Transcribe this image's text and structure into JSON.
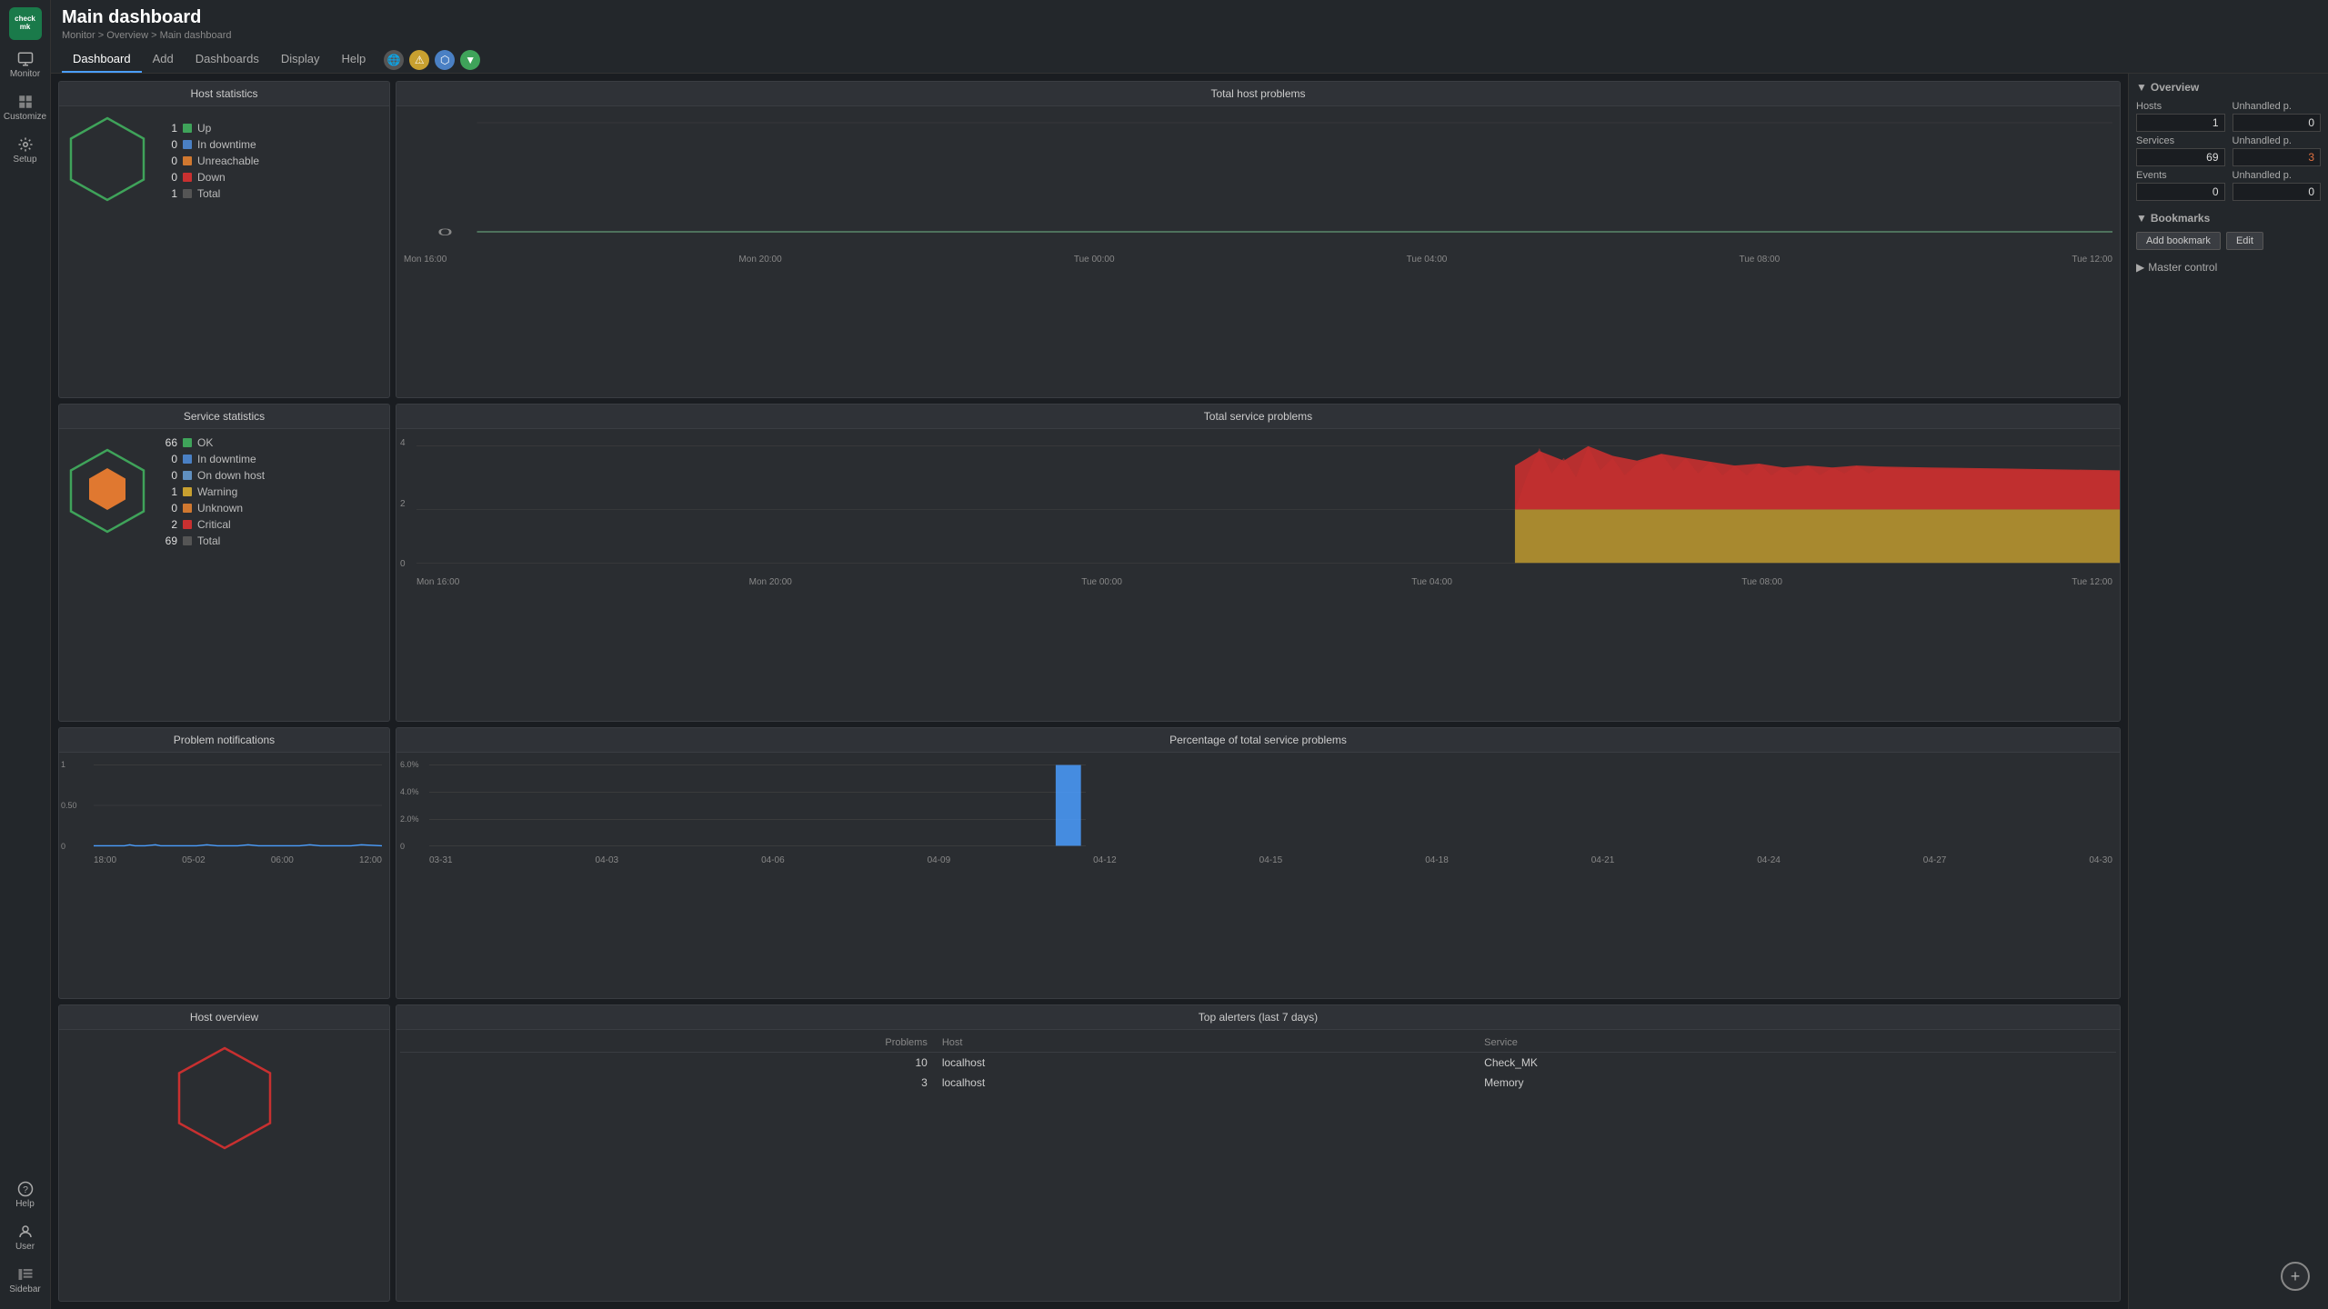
{
  "app": {
    "name": "checkmk",
    "logo_text": "check\nmk"
  },
  "header": {
    "title": "Main dashboard",
    "breadcrumb": "Monitor > Overview > Main dashboard"
  },
  "nav_tabs": [
    {
      "label": "Dashboard",
      "active": true
    },
    {
      "label": "Add",
      "active": false
    },
    {
      "label": "Dashboards",
      "active": false
    },
    {
      "label": "Display",
      "active": false
    },
    {
      "label": "Help",
      "active": false
    }
  ],
  "left_nav": [
    {
      "label": "Monitor",
      "icon": "monitor"
    },
    {
      "label": "Customize",
      "icon": "customize"
    },
    {
      "label": "Setup",
      "icon": "setup"
    }
  ],
  "left_nav_bottom": [
    {
      "label": "Help",
      "icon": "help"
    },
    {
      "label": "User",
      "icon": "user"
    },
    {
      "label": "Sidebar",
      "icon": "sidebar"
    }
  ],
  "host_statistics": {
    "title": "Host statistics",
    "stats": [
      {
        "num": "1",
        "label": "Up",
        "color": "green"
      },
      {
        "num": "0",
        "label": "In downtime",
        "color": "blue"
      },
      {
        "num": "0",
        "label": "Unreachable",
        "color": "orange"
      },
      {
        "num": "0",
        "label": "Down",
        "color": "red"
      },
      {
        "num": "1",
        "label": "Total",
        "color": "black"
      }
    ]
  },
  "service_statistics": {
    "title": "Service statistics",
    "stats": [
      {
        "num": "66",
        "label": "OK",
        "color": "green"
      },
      {
        "num": "0",
        "label": "In downtime",
        "color": "blue"
      },
      {
        "num": "0",
        "label": "On down host",
        "color": "blue2"
      },
      {
        "num": "1",
        "label": "Warning",
        "color": "yellow"
      },
      {
        "num": "0",
        "label": "Unknown",
        "color": "orange"
      },
      {
        "num": "2",
        "label": "Critical",
        "color": "red"
      },
      {
        "num": "69",
        "label": "Total",
        "color": "black"
      }
    ]
  },
  "total_host_problems": {
    "title": "Total host problems",
    "x_labels": [
      "Mon 16:00",
      "Mon 20:00",
      "Tue 00:00",
      "Tue 04:00",
      "Tue 08:00",
      "Tue 12:00"
    ],
    "y_label": "0"
  },
  "total_service_problems": {
    "title": "Total service problems",
    "x_labels": [
      "Mon 16:00",
      "Mon 20:00",
      "Tue 00:00",
      "Tue 04:00",
      "Tue 08:00",
      "Tue 12:00"
    ],
    "y_labels": [
      "0",
      "2",
      "4"
    ]
  },
  "problem_notifications": {
    "title": "Problem notifications",
    "y_labels": [
      "0",
      "0.50",
      "1"
    ],
    "x_labels": [
      "18:00",
      "05-02",
      "06:00",
      "12:00"
    ]
  },
  "pct_service_problems": {
    "title": "Percentage of total service problems",
    "y_labels": [
      "0",
      "2.0%",
      "4.0%",
      "6.0%"
    ],
    "x_labels": [
      "03-31",
      "04-03",
      "04-06",
      "04-09",
      "04-12",
      "04-15",
      "04-18",
      "04-21",
      "04-24",
      "04-27",
      "04-30"
    ]
  },
  "host_overview": {
    "title": "Host overview"
  },
  "top_alerters": {
    "title": "Top alerters (last 7 days)",
    "columns": [
      "Problems",
      "Host",
      "Service"
    ],
    "rows": [
      {
        "problems": "10",
        "host": "localhost",
        "service": "Check_MK"
      },
      {
        "problems": "3",
        "host": "localhost",
        "service": "Memory"
      }
    ]
  },
  "right_sidebar": {
    "overview": {
      "title": "Overview",
      "hosts_label": "Hosts",
      "hosts_value": "1",
      "services_label": "Services",
      "services_value": "69",
      "events_label": "Events",
      "events_value": "0",
      "unhandled_p_label": "Unhandled p.",
      "hosts_unhandled": "0",
      "services_unhandled": "3",
      "events_unhandled": "0"
    },
    "bookmarks": {
      "title": "Bookmarks",
      "add_label": "Add bookmark",
      "edit_label": "Edit"
    },
    "master_control": {
      "title": "Master control"
    }
  }
}
